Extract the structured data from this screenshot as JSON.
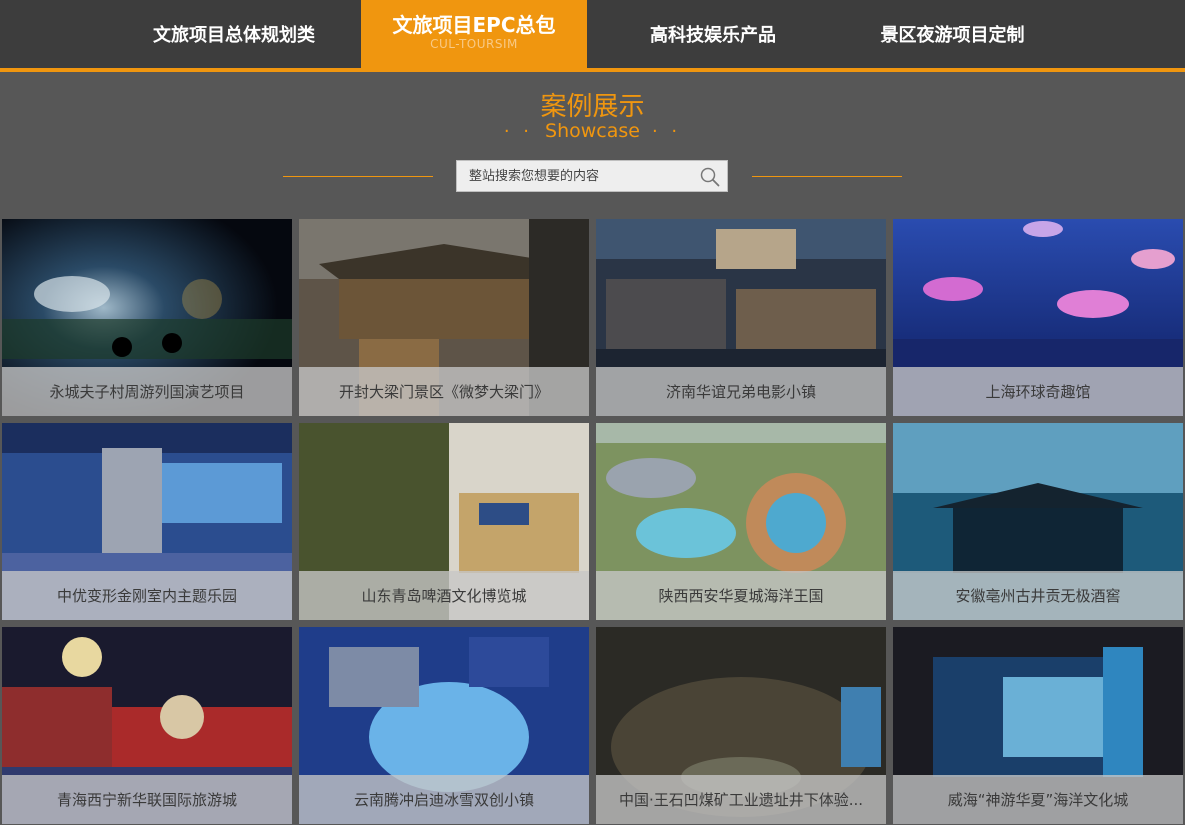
{
  "nav": {
    "items": [
      {
        "label": "文旅项目总体规划类"
      },
      {
        "label": "文旅项目EPC总包",
        "sub": "CUL-TOURSIM"
      },
      {
        "label": "高科技娱乐产品"
      },
      {
        "label": "景区夜游项目定制"
      }
    ]
  },
  "section": {
    "title_cn": "案例展示",
    "title_en": "Showcase",
    "dots": "· ·"
  },
  "search": {
    "placeholder": "整站搜索您想要的内容"
  },
  "colors": {
    "accent": "#f0960f",
    "nav_bg": "#3d3d3d",
    "page_bg": "#575757"
  },
  "cases": [
    {
      "title": "永城夫子村周游列国演艺项目"
    },
    {
      "title": "开封大梁门景区《微梦大梁门》"
    },
    {
      "title": "济南华谊兄弟电影小镇"
    },
    {
      "title": "上海环球奇趣馆"
    },
    {
      "title": "中优变形金刚室内主题乐园"
    },
    {
      "title": "山东青岛啤酒文化博览城"
    },
    {
      "title": "陕西西安华夏城海洋王国"
    },
    {
      "title": "安徽亳州古井贡无极酒窖"
    },
    {
      "title": "青海西宁新华联国际旅游城"
    },
    {
      "title": "云南腾冲启迪冰雪双创小镇"
    },
    {
      "title": "中国·王石凹煤矿工业遗址井下体验..."
    },
    {
      "title": "威海“神游华夏”海洋文化城"
    }
  ]
}
